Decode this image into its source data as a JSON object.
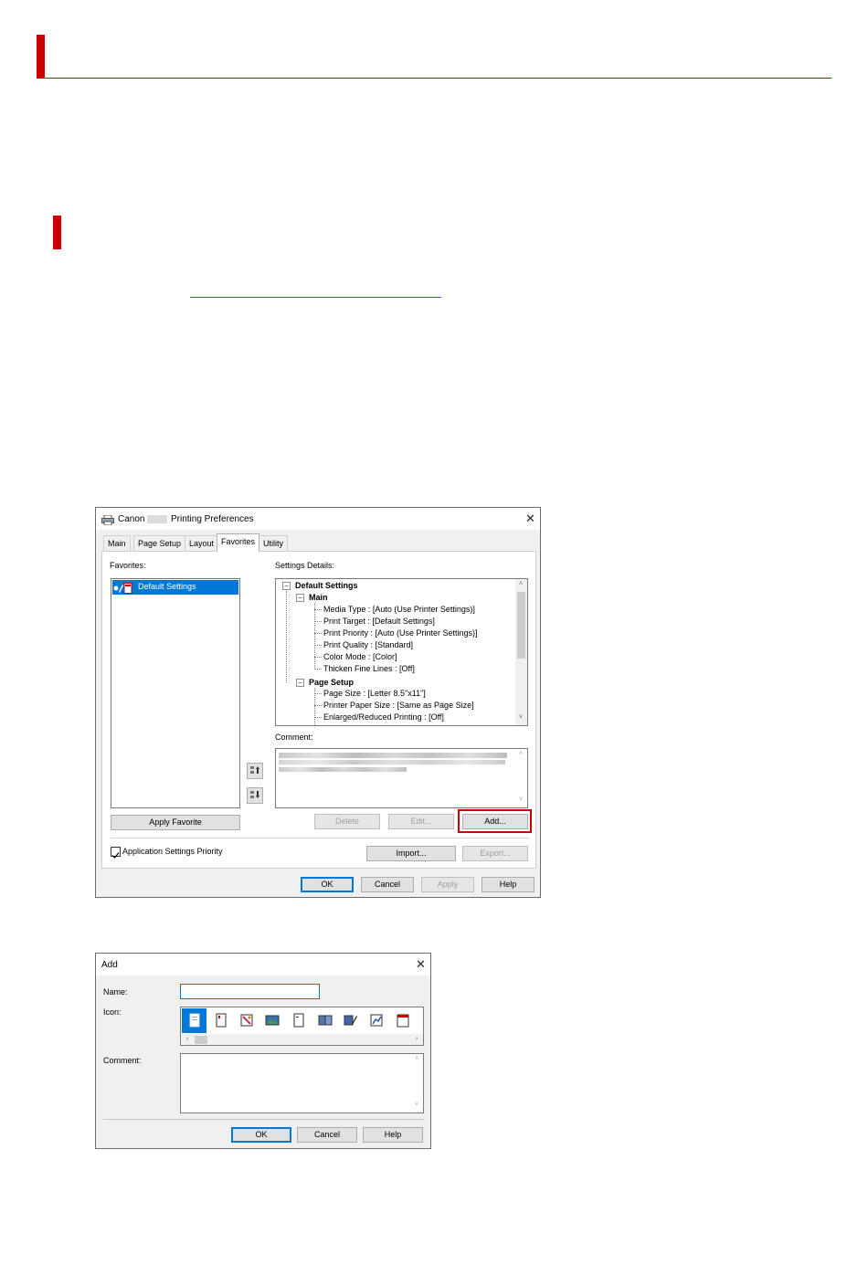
{
  "colors": {
    "accent_red": "#cc0000",
    "selection_blue": "#0078d7",
    "highlight_border": "#cc0000"
  },
  "prefs": {
    "title": "Canon Printing Preferences",
    "title_prefix": "Canon",
    "title_suffix": "Printing Preferences",
    "tabs": [
      "Main",
      "Page Setup",
      "Layout",
      "Favorites",
      "Utility"
    ],
    "active_tab": "Favorites",
    "favorites_label": "Favorites:",
    "favorites_items": [
      "Default Settings"
    ],
    "settings_details_label": "Settings Details:",
    "tree": {
      "root": "Default Settings",
      "main_label": "Main",
      "main_items": [
        "Media Type : [Auto (Use Printer Settings)]",
        "Print Target : [Default Settings]",
        "Print Priority : [Auto (Use Printer Settings)]",
        "Print Quality : [Standard]",
        "Color Mode : [Color]",
        "Thicken Fine Lines : [Off]"
      ],
      "page_setup_label": "Page Setup",
      "page_setup_items": [
        "Page Size : [Letter 8.5\"x11\"]",
        "Printer Paper Size : [Same as Page Size]",
        "Enlarged/Reduced Printing : [Off]"
      ]
    },
    "comment_label": "Comment:",
    "buttons": {
      "apply_favorite": "Apply Favorite",
      "delete": "Delete",
      "edit": "Edit...",
      "add": "Add...",
      "import": "Import...",
      "export": "Export...",
      "ok": "OK",
      "cancel": "Cancel",
      "apply": "Apply",
      "help": "Help"
    },
    "app_settings_priority": {
      "label": "Application Settings Priority",
      "checked": true
    }
  },
  "add_dialog": {
    "title": "Add",
    "name_label": "Name:",
    "name_value": "",
    "icon_label": "Icon:",
    "icons": [
      "document-icon",
      "portrait-icon",
      "photo-icon",
      "landscape-photo-icon",
      "page-icon",
      "booklet-icon",
      "pen-icon",
      "chart-icon",
      "calendar-icon"
    ],
    "comment_label": "Comment:",
    "comment_value": "",
    "buttons": {
      "ok": "OK",
      "cancel": "Cancel",
      "help": "Help"
    }
  }
}
